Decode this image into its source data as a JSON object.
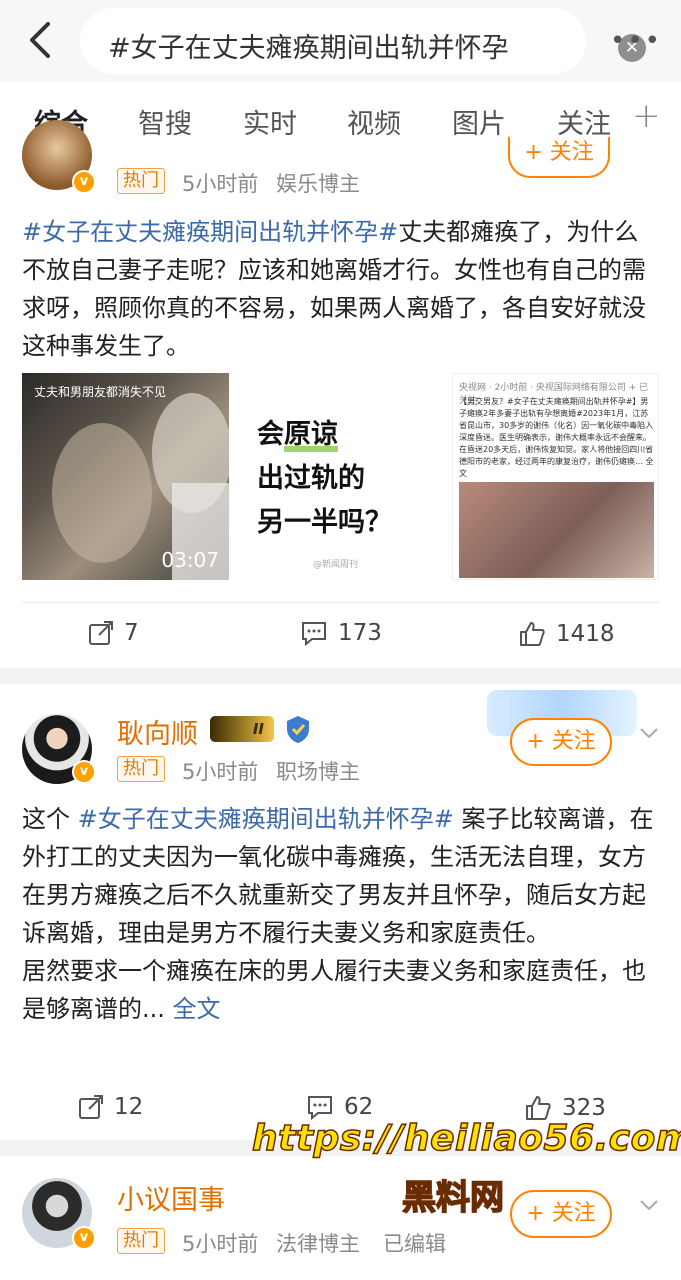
{
  "header": {
    "search_query": "#女子在丈夫瘫痪期间出轨并怀孕",
    "clear_icon": "clear-icon",
    "more_label": "•••"
  },
  "tabs": [
    {
      "label": "综合",
      "active": true
    },
    {
      "label": "智搜"
    },
    {
      "label": "实时"
    },
    {
      "label": "视频"
    },
    {
      "label": "图片"
    },
    {
      "label": "关注"
    }
  ],
  "colors": {
    "accent": "#ff8200",
    "link": "#3d6aa8",
    "name": "#e36f00"
  },
  "posts": [
    {
      "badge": "热门",
      "time": "5小时前",
      "category": "娱乐博主",
      "follow": "+ 关注",
      "tag": "#女子在丈夫瘫痪期间出轨并怀孕#",
      "text": "丈夫都瘫痪了，为什么不放自己妻子走呢？应该和她离婚才行。女性也有自己的需求呀，照顾你真的不容易，如果两人离婚了，各自安好就没这种事发生了。",
      "video_caption": "丈夫和男朋友都消失不见",
      "video_duration": "03:07",
      "image_question_1": "会",
      "image_question_2": "原谅",
      "image_question_3": "出过轨的",
      "image_question_4": "另一半吗？",
      "image_watermark": "@新闻周刊",
      "news_header": "央视网 · 2小时前 · 央视国际网络有限公司  + 已关注",
      "news_body": "【男交男友？#女子在丈夫瘫痪期间出轨并怀孕#】男子瘫痪2年多妻子出轨有孕想离婚#2023年1月，江苏省昆山市，30多岁的谢伟（化名）因一氧化碳中毒陷入深度昏迷。医生明确表示，谢伟大概率永远不会醒来。在昏迷20多天后，谢伟恢复知觉。家人将他接回四川省德阳市的老家，经过两年的康复治疗，谢伟仍瘫痪… 全文",
      "reposts": "7",
      "comments": "173",
      "likes": "1418"
    },
    {
      "name": "耿向顺",
      "level": "II",
      "badge": "热门",
      "time": "5小时前",
      "category": "职场博主",
      "follow": "+ 关注",
      "text_pre": "这个 ",
      "tag": "#女子在丈夫瘫痪期间出轨并怀孕#",
      "text_main": " 案子比较离谱，在外打工的丈夫因为一氧化碳中毒瘫痪，生活无法自理，女方在男方瘫痪之后不久就重新交了男友并且怀孕，随后女方起诉离婚，理由是男方不履行夫妻义务和家庭责任。",
      "text_second": "居然要求一个瘫痪在床的男人履行夫妻义务和家庭责任，也是够离谱的...",
      "more_link": "全文",
      "reposts": "12",
      "comments": "62",
      "likes": "323"
    },
    {
      "name": "小议国事",
      "badge": "热门",
      "time": "5小时前",
      "category": "法律博主",
      "edited": "已编辑",
      "follow": "+ 关注"
    }
  ],
  "watermark": {
    "url": "https://heiliao56.com",
    "site": "黑料网"
  }
}
